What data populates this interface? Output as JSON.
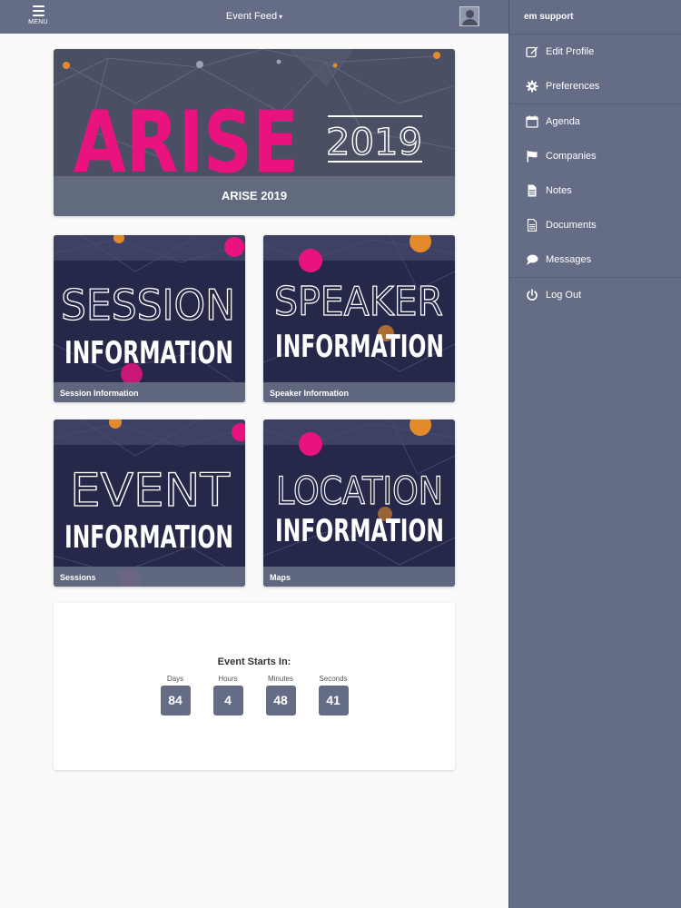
{
  "topbar": {
    "menu_label": "MENU",
    "feed_title": "Event Feed",
    "caret": "▾"
  },
  "side_panel": {
    "user": "em support",
    "items": [
      {
        "label": "Edit Profile",
        "icon": "edit-icon"
      },
      {
        "label": "Preferences",
        "icon": "gear-icon"
      },
      {
        "label": "Agenda",
        "icon": "calendar-icon"
      },
      {
        "label": "Companies",
        "icon": "flag-icon"
      },
      {
        "label": "Notes",
        "icon": "note-icon"
      },
      {
        "label": "Documents",
        "icon": "document-icon"
      },
      {
        "label": "Messages",
        "icon": "chat-bubble-icon"
      },
      {
        "label": "Log Out",
        "icon": "power-icon"
      }
    ]
  },
  "banner": {
    "logo_word": "ARISE",
    "logo_year": "2019",
    "caption": "ARISE 2019"
  },
  "tiles": [
    {
      "line1": "SESSION",
      "line2": "INFORMATION",
      "caption": "Session Information"
    },
    {
      "line1": "SPEAKER",
      "line2": "INFORMATION",
      "caption": "Speaker Information"
    },
    {
      "line1": "EVENT",
      "line2": "INFORMATION",
      "caption": "Sessions"
    },
    {
      "line1": "LOCATION",
      "line2": "INFORMATION",
      "caption": "Maps"
    }
  ],
  "countdown": {
    "title": "Event Starts In:",
    "units": [
      {
        "label": "Days",
        "value": "84"
      },
      {
        "label": "Hours",
        "value": "4"
      },
      {
        "label": "Minutes",
        "value": "48"
      },
      {
        "label": "Seconds",
        "value": "41"
      }
    ]
  },
  "colors": {
    "bar": "#656d86",
    "magenta": "#e8137f",
    "orange": "#e58a2a",
    "tile_bg": "#26284a"
  }
}
